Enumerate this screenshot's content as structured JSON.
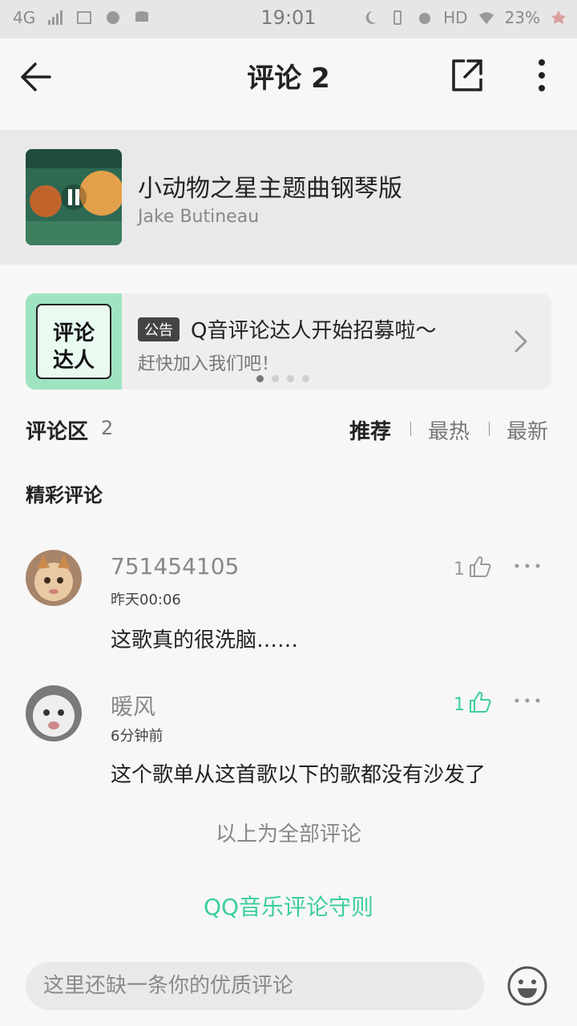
{
  "status_bar": {
    "network": "4G",
    "time": "19:01",
    "hd": "HD",
    "battery": "23%"
  },
  "header": {
    "title": "评论 2"
  },
  "song": {
    "title": "小动物之星主题曲钢琴版",
    "artist": "Jake Butineau"
  },
  "announcement": {
    "tag": "公告",
    "title": "Q音评论达人开始招募啦～",
    "subtitle": "赶快加入我们吧！",
    "image_text_top": "评论",
    "image_text_bottom": "达人"
  },
  "comment_area": {
    "title": "评论区",
    "count": "2",
    "sort_options": [
      "推荐",
      "最热",
      "最新"
    ],
    "featured_label": "精彩评论"
  },
  "comments": [
    {
      "user": "751454105",
      "time": "昨天00:06",
      "text": "这歌真的很洗脑……",
      "likes": "1",
      "like_color": "#9a9a9a"
    },
    {
      "user": "暖风",
      "time": "6分钟前",
      "text": "这个歌单从这首歌以下的歌都没有沙发了",
      "likes": "1",
      "like_color": "#3ccf9a"
    }
  ],
  "footer": {
    "end_text": "以上为全部评论",
    "rules_link": "QQ音乐评论守则"
  },
  "input": {
    "placeholder": "这里还缺一条你的优质评论"
  },
  "colors": {
    "accent": "#3ccf9a"
  }
}
